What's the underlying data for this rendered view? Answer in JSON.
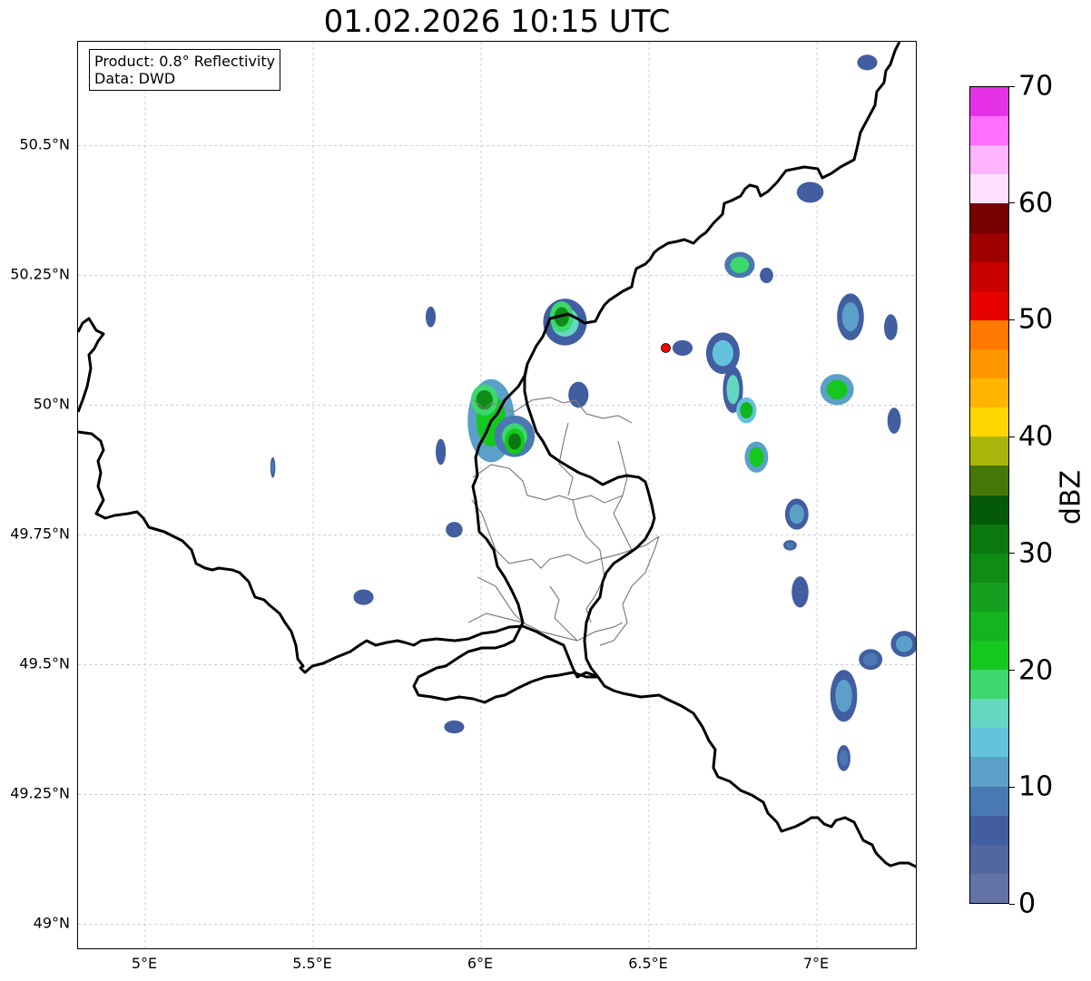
{
  "title": "01.02.2026 10:15 UTC",
  "info": {
    "product": "Product: 0.8° Reflectivity",
    "data": "Data: DWD"
  },
  "map": {
    "lon_range": [
      4.8,
      7.3
    ],
    "lat_range": [
      48.95,
      50.7
    ],
    "lat_ticks": [
      {
        "value": 49.0,
        "label": "49°N"
      },
      {
        "value": 49.25,
        "label": "49.25°N"
      },
      {
        "value": 49.5,
        "label": "49.5°N"
      },
      {
        "value": 49.75,
        "label": "49.75°N"
      },
      {
        "value": 50.0,
        "label": "50°N"
      },
      {
        "value": 50.25,
        "label": "50.25°N"
      },
      {
        "value": 50.5,
        "label": "50.5°N"
      }
    ],
    "lon_ticks": [
      {
        "value": 5.0,
        "label": "5°E"
      },
      {
        "value": 5.5,
        "label": "5.5°E"
      },
      {
        "value": 6.0,
        "label": "6°E"
      },
      {
        "value": 6.5,
        "label": "6.5°E"
      },
      {
        "value": 7.0,
        "label": "7°E"
      }
    ],
    "radar_site": {
      "lon": 6.55,
      "lat": 50.11,
      "color": "#ff0000"
    },
    "gridline_color": "#b0b0b0",
    "border_color": "#000000",
    "district_color": "#808080"
  },
  "colorbar": {
    "unit": "dBZ",
    "min": 0,
    "max": 70,
    "ticks": [
      {
        "value": 0,
        "label": "0"
      },
      {
        "value": 10,
        "label": "10"
      },
      {
        "value": 20,
        "label": "20"
      },
      {
        "value": 30,
        "label": "30"
      },
      {
        "value": 40,
        "label": "40"
      },
      {
        "value": 50,
        "label": "50"
      },
      {
        "value": 60,
        "label": "60"
      },
      {
        "value": 70,
        "label": "70"
      }
    ],
    "colors": [
      "#6473a6",
      "#5267a0",
      "#425ea1",
      "#4a78b0",
      "#5aa0c8",
      "#64c3dc",
      "#64d7c3",
      "#3cd76e",
      "#14c81e",
      "#14b41e",
      "#14a01e",
      "#0f8c14",
      "#0a780f",
      "#055a0a",
      "#467808",
      "#aab40a",
      "#ffd700",
      "#ffb400",
      "#ff9600",
      "#ff7800",
      "#e60000",
      "#c80000",
      "#a00000",
      "#780000",
      "#ffe1ff",
      "#ffb4ff",
      "#ff6eff",
      "#e632e6"
    ]
  },
  "echoes": [
    {
      "lon": 5.38,
      "lat": 49.88,
      "w": 0.015,
      "h": 0.04,
      "dbz": 8
    },
    {
      "lon": 5.65,
      "lat": 49.63,
      "w": 0.06,
      "h": 0.03,
      "dbz": 7
    },
    {
      "lon": 5.92,
      "lat": 49.76,
      "w": 0.05,
      "h": 0.03,
      "dbz": 6
    },
    {
      "lon": 5.88,
      "lat": 49.91,
      "w": 0.03,
      "h": 0.05,
      "dbz": 5
    },
    {
      "lon": 5.92,
      "lat": 49.38,
      "w": 0.06,
      "h": 0.025,
      "dbz": 7
    },
    {
      "lon": 5.85,
      "lat": 50.17,
      "w": 0.03,
      "h": 0.04,
      "dbz": 6
    },
    {
      "lon": 6.03,
      "lat": 49.97,
      "w": 0.14,
      "h": 0.16,
      "dbz": 20
    },
    {
      "lon": 6.01,
      "lat": 50.01,
      "w": 0.08,
      "h": 0.06,
      "dbz": 28
    },
    {
      "lon": 6.1,
      "lat": 49.94,
      "w": 0.12,
      "h": 0.08,
      "dbz": 18
    },
    {
      "lon": 6.1,
      "lat": 49.93,
      "w": 0.06,
      "h": 0.05,
      "dbz": 30
    },
    {
      "lon": 6.25,
      "lat": 50.16,
      "w": 0.13,
      "h": 0.09,
      "dbz": 17
    },
    {
      "lon": 6.24,
      "lat": 50.17,
      "w": 0.07,
      "h": 0.06,
      "dbz": 29
    },
    {
      "lon": 6.29,
      "lat": 50.02,
      "w": 0.06,
      "h": 0.05,
      "dbz": 7
    },
    {
      "lon": 6.6,
      "lat": 50.11,
      "w": 0.06,
      "h": 0.03,
      "dbz": 6
    },
    {
      "lon": 6.72,
      "lat": 50.1,
      "w": 0.1,
      "h": 0.08,
      "dbz": 14
    },
    {
      "lon": 6.75,
      "lat": 50.03,
      "w": 0.06,
      "h": 0.09,
      "dbz": 16
    },
    {
      "lon": 6.79,
      "lat": 49.99,
      "w": 0.06,
      "h": 0.05,
      "dbz": 24
    },
    {
      "lon": 6.82,
      "lat": 49.9,
      "w": 0.07,
      "h": 0.06,
      "dbz": 22
    },
    {
      "lon": 6.77,
      "lat": 50.27,
      "w": 0.09,
      "h": 0.05,
      "dbz": 18
    },
    {
      "lon": 6.85,
      "lat": 50.25,
      "w": 0.04,
      "h": 0.03,
      "dbz": 7
    },
    {
      "lon": 6.94,
      "lat": 49.79,
      "w": 0.07,
      "h": 0.06,
      "dbz": 10
    },
    {
      "lon": 6.92,
      "lat": 49.73,
      "w": 0.04,
      "h": 0.02,
      "dbz": 8
    },
    {
      "lon": 6.95,
      "lat": 49.64,
      "w": 0.05,
      "h": 0.06,
      "dbz": 7
    },
    {
      "lon": 6.98,
      "lat": 50.41,
      "w": 0.08,
      "h": 0.04,
      "dbz": 6
    },
    {
      "lon": 7.06,
      "lat": 50.03,
      "w": 0.1,
      "h": 0.06,
      "dbz": 22
    },
    {
      "lon": 7.1,
      "lat": 50.17,
      "w": 0.08,
      "h": 0.09,
      "dbz": 10
    },
    {
      "lon": 7.22,
      "lat": 50.15,
      "w": 0.04,
      "h": 0.05,
      "dbz": 7
    },
    {
      "lon": 7.23,
      "lat": 49.97,
      "w": 0.04,
      "h": 0.05,
      "dbz": 6
    },
    {
      "lon": 7.15,
      "lat": 50.66,
      "w": 0.06,
      "h": 0.03,
      "dbz": 6
    },
    {
      "lon": 7.08,
      "lat": 49.44,
      "w": 0.08,
      "h": 0.1,
      "dbz": 11
    },
    {
      "lon": 7.16,
      "lat": 49.51,
      "w": 0.07,
      "h": 0.04,
      "dbz": 8
    },
    {
      "lon": 7.26,
      "lat": 49.54,
      "w": 0.08,
      "h": 0.05,
      "dbz": 12
    },
    {
      "lon": 7.08,
      "lat": 49.32,
      "w": 0.04,
      "h": 0.05,
      "dbz": 9
    }
  ]
}
